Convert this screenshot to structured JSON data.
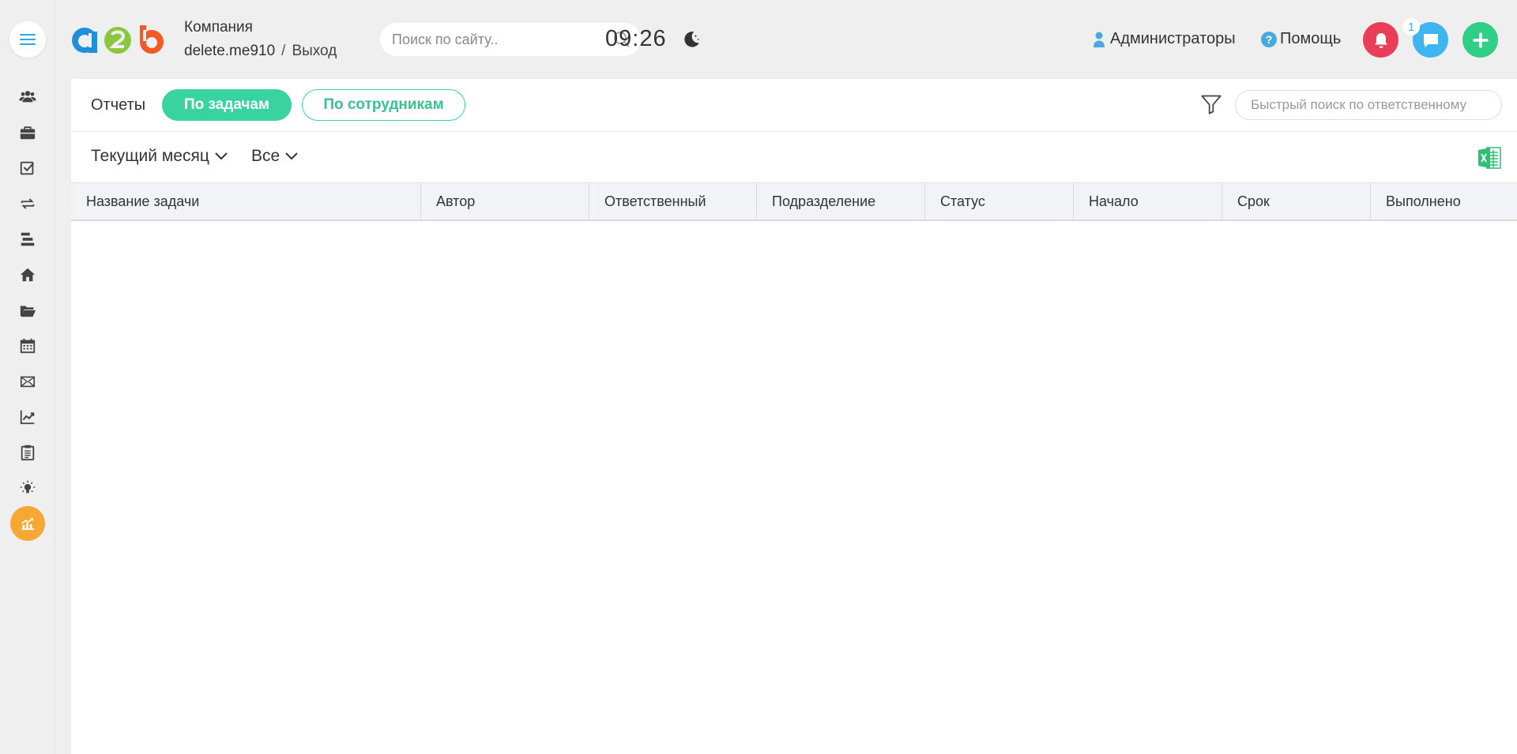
{
  "header": {
    "company_label": "Компания",
    "username": "delete.me910",
    "separator": "/",
    "logout": "Выход",
    "search_placeholder": "Поиск по сайту..",
    "time": "09:26",
    "admins": "Администраторы",
    "help": "Помощь",
    "chat_count": "1"
  },
  "sidebar": {
    "items": [
      "users-icon",
      "briefcase-icon",
      "checkbox-icon",
      "exchange-icon",
      "stack-icon",
      "home-icon",
      "folder-open-icon",
      "calendar-icon",
      "envelope-icon",
      "chart-line-icon",
      "clipboard-icon",
      "lightbulb-icon",
      "reports-chart-icon"
    ],
    "active": "reports-chart-icon"
  },
  "reports": {
    "label": "Отчеты",
    "tab_tasks": "По задачам",
    "tab_staff": "По сотрудникам",
    "quick_search_placeholder": "Быстрый поиск по ответственному",
    "period": "Текущий месяц",
    "scope": "Все"
  },
  "table": {
    "columns": [
      "Название задачи",
      "Автор",
      "Ответственный",
      "Подразделение",
      "Статус",
      "Начало",
      "Срок",
      "Выполнено"
    ],
    "rows": []
  },
  "colors": {
    "accent_green": "#38d39f",
    "bell_red": "#ea3d57",
    "chat_blue": "#3fb5f0",
    "plus_green": "#2fcf87",
    "active_orange": "#f7a734"
  }
}
